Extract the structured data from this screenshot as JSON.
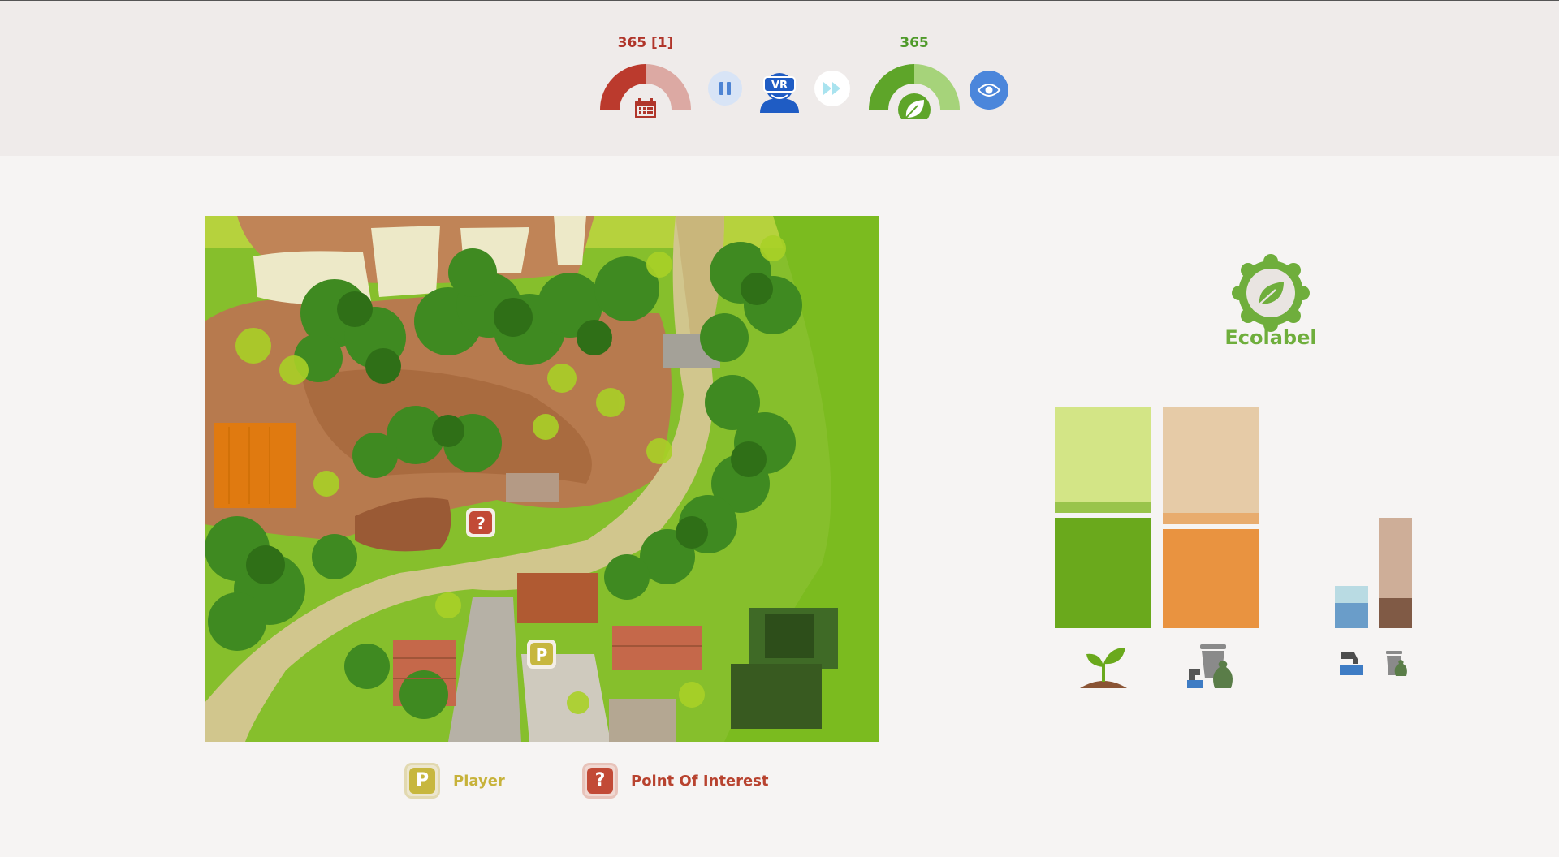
{
  "top_bar": {
    "days_gauge": {
      "label": "365 [1]",
      "level": 0.5,
      "icon": "calendar-icon",
      "color_filled": "#bb3a2d",
      "color_empty": "#dca9a3"
    },
    "pause_button": {
      "icon": "pause-icon"
    },
    "vr_player": {
      "text": "VR",
      "icon": "vr-headset-icon"
    },
    "fast_forward_button": {
      "icon": "fast-forward-icon"
    },
    "eco_gauge": {
      "label": "365",
      "level": 0.5,
      "icon": "leaf-icon",
      "color_filled": "#5ea529",
      "color_empty": "#a6d37a"
    },
    "view_button": {
      "icon": "eye-icon"
    }
  },
  "map": {
    "markers": [
      {
        "type": "point_of_interest",
        "symbol": "?"
      },
      {
        "type": "player",
        "symbol": "P"
      }
    ]
  },
  "legend": {
    "player": {
      "symbol": "P",
      "label": "Player",
      "color": "#c7b73e"
    },
    "poi": {
      "symbol": "?",
      "label": "Point Of Interest",
      "color": "#c24a36"
    }
  },
  "ecolabel": {
    "label": "Ecolabel",
    "icon": "leaf-badge-icon",
    "color": "#6fae3c"
  },
  "stats": {
    "bars": [
      {
        "name": "plant",
        "icon": "sprout-icon",
        "fill_fraction": 0.5,
        "color_fill": "#6aa91c",
        "color_empty": "#d3e586"
      },
      {
        "name": "waste",
        "icon": "waste-icon",
        "fill_fraction": 0.45,
        "color_fill": "#e99340",
        "color_empty": "#e6cba7"
      },
      {
        "name": "water",
        "icon": "water-tap-icon",
        "fill_fraction": 0.6,
        "color_fill": "#6a9dc9",
        "color_empty": "#b9dbe3"
      },
      {
        "name": "trash",
        "icon": "trash-icon",
        "fill_fraction": 0.27,
        "color_fill": "#805a45",
        "color_empty": "#ceae98"
      }
    ]
  }
}
